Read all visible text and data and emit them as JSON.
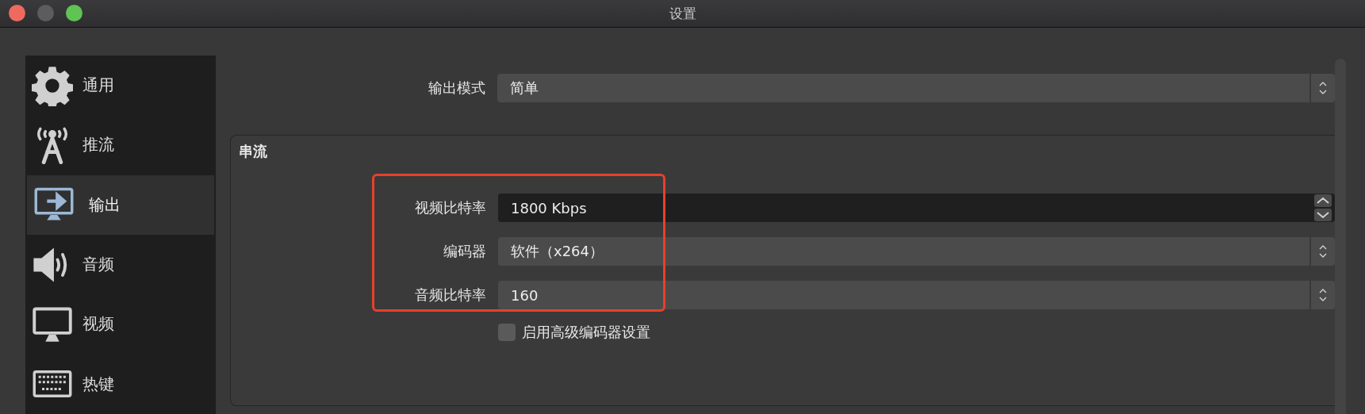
{
  "window": {
    "title": "设置"
  },
  "sidebar": {
    "items": [
      {
        "label": "通用",
        "kind": "gear",
        "selected": false
      },
      {
        "label": "推流",
        "kind": "antenna",
        "selected": false
      },
      {
        "label": "输出",
        "kind": "output",
        "selected": true
      },
      {
        "label": "音频",
        "kind": "speaker",
        "selected": false
      },
      {
        "label": "视频",
        "kind": "monitor",
        "selected": false
      },
      {
        "label": "热键",
        "kind": "keyboard",
        "selected": false
      }
    ]
  },
  "output_mode": {
    "label": "输出模式",
    "value": "简单"
  },
  "group": {
    "title": "串流",
    "fields": [
      {
        "label": "视频比特率",
        "value": "1800 Kbps",
        "kind": "spin"
      },
      {
        "label": "编码器",
        "value": "软件（x264）",
        "kind": "combo"
      },
      {
        "label": "音频比特率",
        "value": "160",
        "kind": "combo"
      }
    ],
    "checkbox": {
      "label": "启用高级编码器设置",
      "checked": false
    }
  }
}
